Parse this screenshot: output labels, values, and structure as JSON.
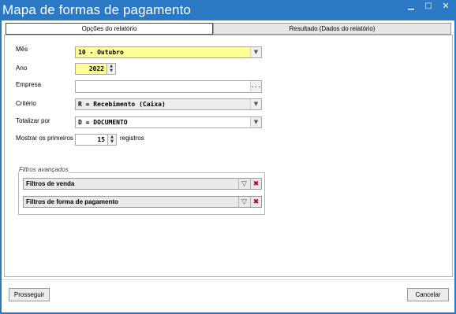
{
  "window": {
    "title": "Mapa de formas de pagamento",
    "controls": {
      "minimize": "▁",
      "maximize": "□",
      "close": "✕"
    }
  },
  "tabs": [
    {
      "label": "Opções do relatório",
      "active": true
    },
    {
      "label": "Resultado (Dados do relatório)",
      "active": false
    }
  ],
  "form": {
    "mes": {
      "label": "Mês",
      "value": "10 - Outubro"
    },
    "ano": {
      "label": "Ano",
      "value": "2022"
    },
    "empresa": {
      "label": "Empresa",
      "value": "",
      "button": "..."
    },
    "criterio": {
      "label": "Critério",
      "value": "R = Recebimento (Caixa)"
    },
    "totalizar": {
      "label": "Totalizar por",
      "value": "D = DOCUMENTO"
    },
    "mostrar": {
      "label": "Mostrar os primeiros",
      "value": "15",
      "suffix": "registros"
    }
  },
  "filtros": {
    "title": "Filtros avançados",
    "items": [
      {
        "label": "Filtros de venda"
      },
      {
        "label": "Filtros de forma de pagamento"
      }
    ]
  },
  "footer": {
    "prosseguir": "Prosseguir",
    "cancelar": "Cancelar"
  },
  "colors": {
    "titlebar": "#2b78c4",
    "highlight_field": "#ffff99",
    "clear_filter_icon": "#b00020"
  },
  "icons": {
    "dropdown": "chevron-down-icon",
    "spin_up": "triangle-up-icon",
    "spin_down": "triangle-down-icon",
    "filter": "funnel-icon",
    "clear_filter": "clear-filter-icon"
  }
}
